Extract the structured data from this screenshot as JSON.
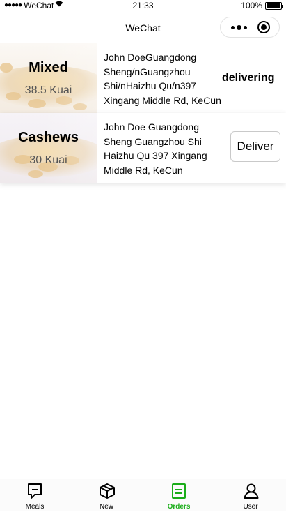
{
  "status_bar": {
    "carrier": "WeChat",
    "time": "21:33",
    "battery": "100%"
  },
  "nav": {
    "title": "WeChat",
    "icons": [
      "more-icon",
      "close-circle-icon"
    ]
  },
  "orders": [
    {
      "name": "Mixed",
      "price": "38.5 Kuai",
      "address": "John DoeGuangdong Sheng/nGuangzhou Shi/nHaizhu Qu/n397 Xingang Middle Rd, KeCun",
      "status": "delivering"
    },
    {
      "name": "Cashews",
      "price": "30 Kuai",
      "address": "John Doe Guangdong Sheng Guangzhou Shi Haizhu Qu 397 Xingang Middle Rd, KeCun",
      "action": "Deliver"
    }
  ],
  "tabbar": {
    "active_color": "#1aad19",
    "items": [
      {
        "label": "Meals",
        "icon": "chat-box-icon"
      },
      {
        "label": "New",
        "icon": "box-icon"
      },
      {
        "label": "Orders",
        "icon": "list-icon",
        "active": true
      },
      {
        "label": "User",
        "icon": "user-icon"
      }
    ]
  }
}
